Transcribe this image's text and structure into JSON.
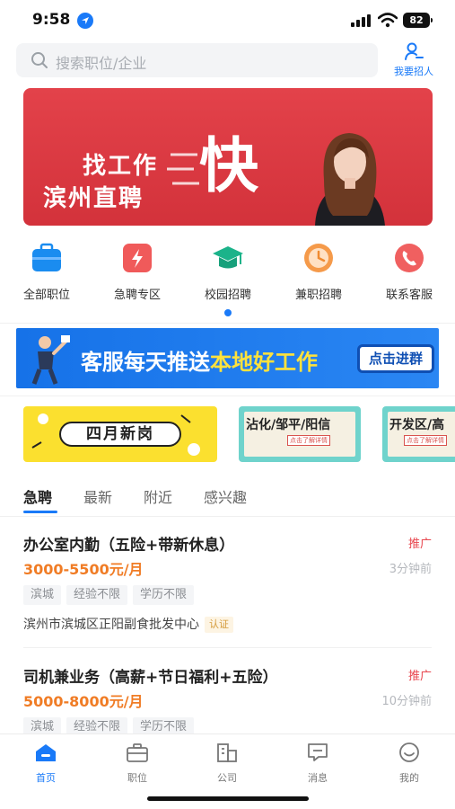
{
  "status": {
    "time": "9:58",
    "battery": "82"
  },
  "search": {
    "placeholder": "搜索职位/企业"
  },
  "recruit": {
    "label": "我要招人"
  },
  "banner": {
    "line1": "找工作",
    "line2": "滨州直聘",
    "big": "快"
  },
  "categories": [
    {
      "label": "全部职位",
      "icon": "briefcase-icon",
      "color": "#1a8cf0"
    },
    {
      "label": "急聘专区",
      "icon": "lightning-icon",
      "color": "#f05a5a"
    },
    {
      "label": "校园招聘",
      "icon": "graduation-cap-icon",
      "color": "#1bb38a"
    },
    {
      "label": "兼职招聘",
      "icon": "clock-icon",
      "color": "#f59a4a"
    },
    {
      "label": "联系客服",
      "icon": "phone-icon",
      "color": "#f06060"
    }
  ],
  "promo": {
    "text_a": "客服每天推送",
    "text_b": "本地好工作",
    "button": "点击进群"
  },
  "cards": [
    {
      "title": "四月新岗"
    },
    {
      "title": "沾化/邹平/阳信",
      "sub": "点击了解详情"
    },
    {
      "title": "开发区/高",
      "sub": "点击了解详情"
    }
  ],
  "tabs": [
    "急聘",
    "最新",
    "附近",
    "感兴趣"
  ],
  "jobs": [
    {
      "title": "办公室内勤（五险+带新休息）",
      "tag": "推广",
      "salary": "3000-5500元/月",
      "time": "3分钟前",
      "tags": [
        "滨城",
        "经验不限",
        "学历不限"
      ],
      "address": "滨州市滨城区正阳副食批发中心",
      "cert": "认证"
    },
    {
      "title": "司机兼业务（高薪+节日福利+五险）",
      "tag": "推广",
      "salary": "5000-8000元/月",
      "time": "10分钟前",
      "tags": [
        "滨城",
        "经验不限",
        "学历不限"
      ]
    }
  ],
  "nav": [
    {
      "label": "首页",
      "icon": "home-icon",
      "active": true
    },
    {
      "label": "职位",
      "icon": "briefcase-icon"
    },
    {
      "label": "公司",
      "icon": "building-icon"
    },
    {
      "label": "消息",
      "icon": "message-icon"
    },
    {
      "label": "我的",
      "icon": "smile-icon"
    }
  ],
  "colors": {
    "accent": "#1a7af8",
    "salary": "#f07c25",
    "promo_tag": "#e8474f",
    "banner": "#dc3a42"
  }
}
